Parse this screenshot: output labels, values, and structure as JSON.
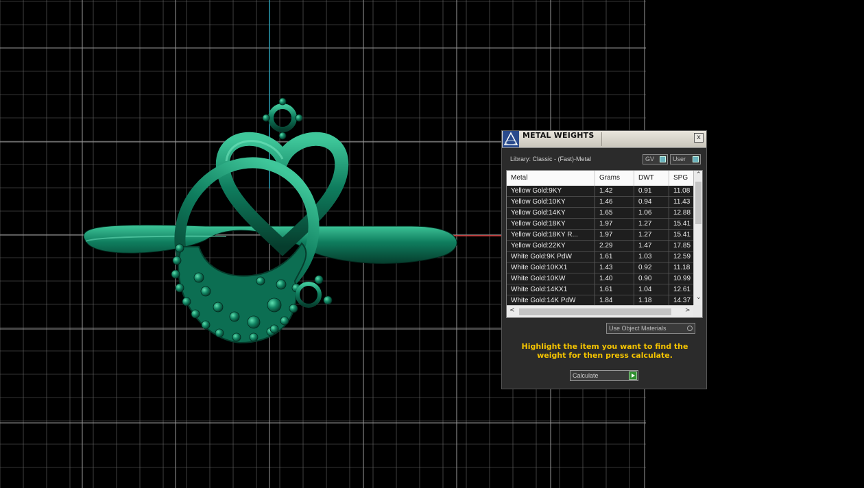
{
  "viewport": {
    "grid_color": "#6b6b6b",
    "axis_y_color": "#2a9bb0",
    "axis_x_color": "#cc2b2b",
    "model_color": "#0f7d5e"
  },
  "panel": {
    "title": "METAL WEIGHTS",
    "close_label": "x",
    "library_label": "Library: Classic - (Fast)-Metal",
    "gv_label": "GV",
    "user_label": "User",
    "columns": [
      "Metal",
      "Grams",
      "DWT",
      "SPG"
    ],
    "rows": [
      [
        "Yellow Gold:9KY",
        "1.42",
        "0.91",
        "11.08"
      ],
      [
        "Yellow Gold:10KY",
        "1.46",
        "0.94",
        "11.43"
      ],
      [
        "Yellow Gold:14KY",
        "1.65",
        "1.06",
        "12.88"
      ],
      [
        "Yellow Gold:18KY",
        "1.97",
        "1.27",
        "15.41"
      ],
      [
        "Yellow Gold:18KY R...",
        "1.97",
        "1.27",
        "15.41"
      ],
      [
        "Yellow Gold:22KY",
        "2.29",
        "1.47",
        "17.85"
      ],
      [
        "White Gold:9K PdW",
        "1.61",
        "1.03",
        "12.59"
      ],
      [
        "White Gold:10KX1",
        "1.43",
        "0.92",
        "11.18"
      ],
      [
        "White Gold:10KW",
        "1.40",
        "0.90",
        "10.99"
      ],
      [
        "White Gold:14KX1",
        "1.61",
        "1.04",
        "12.61"
      ],
      [
        "White Gold:14K PdW",
        "1.84",
        "1.18",
        "14.37"
      ]
    ],
    "use_object_materials_label": "Use Object Materials",
    "hint_text": "Highlight the item you want to find the weight for then press calculate.",
    "calculate_label": "Calculate",
    "accent_hint_color": "#f5c400",
    "scroll_up": "⌃",
    "scroll_down": "⌄",
    "scroll_left": "<",
    "scroll_right": ">"
  }
}
